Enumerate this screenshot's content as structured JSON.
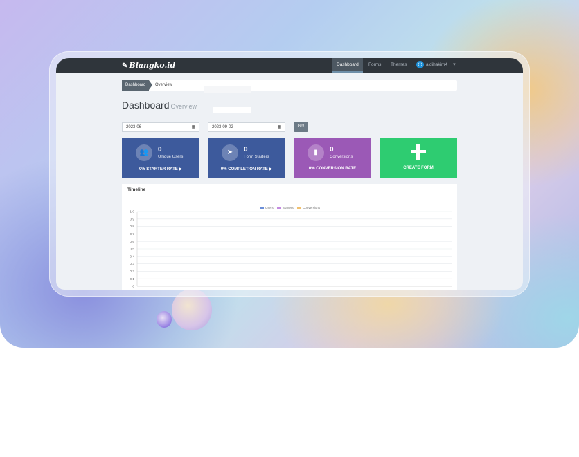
{
  "navbar": {
    "brand": "Blangko.id",
    "items": [
      {
        "label": "Dashboard",
        "active": true
      },
      {
        "label": "Forms",
        "active": false
      },
      {
        "label": "Themes",
        "active": false
      }
    ],
    "user": "aldihakim4"
  },
  "breadcrumb": {
    "items": [
      "Dashboard",
      "Overview"
    ]
  },
  "page": {
    "title": "Dashboard",
    "subtitle": "Overview"
  },
  "filters": {
    "start_date": "2023-06",
    "end_date": "2023-09-02",
    "go_label": "Go!"
  },
  "cards": [
    {
      "value": "0",
      "label": "Unique Users",
      "rate": "0% STARTER RATE",
      "icon": "users-icon",
      "color": "#3d5a9c"
    },
    {
      "value": "0",
      "label": "Form Starters",
      "rate": "0% COMPLETION RATE",
      "icon": "paper-plane-icon",
      "color": "#3d5a9c"
    },
    {
      "value": "0",
      "label": "Conversions",
      "rate": "0% CONVERSION RATE",
      "icon": "bar-chart-icon",
      "color": "#9b59b6"
    },
    {
      "value": "",
      "label": "",
      "rate": "CREATE FORM",
      "icon": "plus-icon",
      "color": "#2ecc71"
    }
  ],
  "timeline": {
    "title": "Timeline"
  },
  "chart_data": {
    "type": "line",
    "title": "",
    "xlabel": "",
    "ylabel": "",
    "ylim": [
      0,
      1.0
    ],
    "yticks": [
      "1.0",
      "0.9",
      "0.8",
      "0.7",
      "0.6",
      "0.5",
      "0.4",
      "0.3",
      "0.2",
      "0.1",
      "0"
    ],
    "legend": "top",
    "grid": true,
    "series": [
      {
        "name": "Users",
        "color": "#6c8fd8",
        "values": []
      },
      {
        "name": "Starters",
        "color": "#c38be0",
        "values": []
      },
      {
        "name": "Conversions",
        "color": "#f0c070",
        "values": []
      }
    ]
  }
}
